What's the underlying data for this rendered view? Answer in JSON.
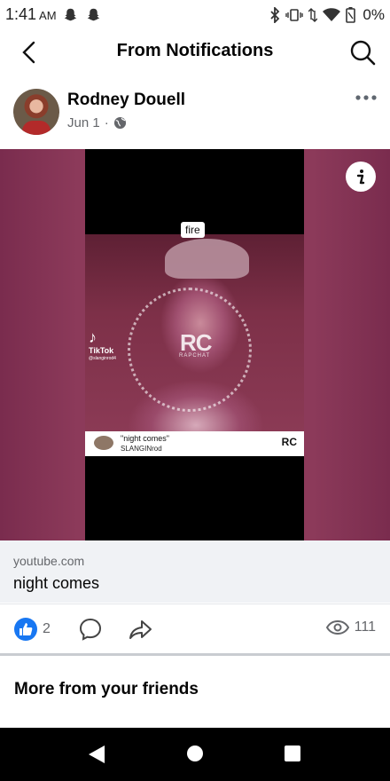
{
  "status_bar": {
    "time": "1:41",
    "ampm": "AM",
    "battery": "0%",
    "icons": [
      "snapchat-icon",
      "snapchat-icon",
      "bluetooth-icon",
      "vibrate-icon",
      "data-icon",
      "wifi-icon",
      "battery-icon"
    ]
  },
  "header": {
    "title": "From Notifications",
    "back_icon": "chevron-left-icon",
    "search_icon": "search-icon"
  },
  "post": {
    "author": "Rodney Douell",
    "date": "Jun 1",
    "separator": "·",
    "privacy_icon": "globe-icon",
    "more_icon": "more-horizontal-icon"
  },
  "media": {
    "overlay_label": "fire",
    "tiktok_label": "TikTok",
    "tiktok_handle": "@slanginrod4",
    "watermark": "RC",
    "watermark_sub": "RAPCHAT",
    "song_title": "\"night comes\"",
    "song_artist": "SLANGINrod",
    "song_logo": "RC",
    "info_icon": "info-icon"
  },
  "link": {
    "domain": "youtube.com",
    "title": "night comes"
  },
  "actions": {
    "like_count": "2",
    "views": "111",
    "accent": "#1877f2"
  },
  "section": {
    "title": "More from your friends"
  }
}
